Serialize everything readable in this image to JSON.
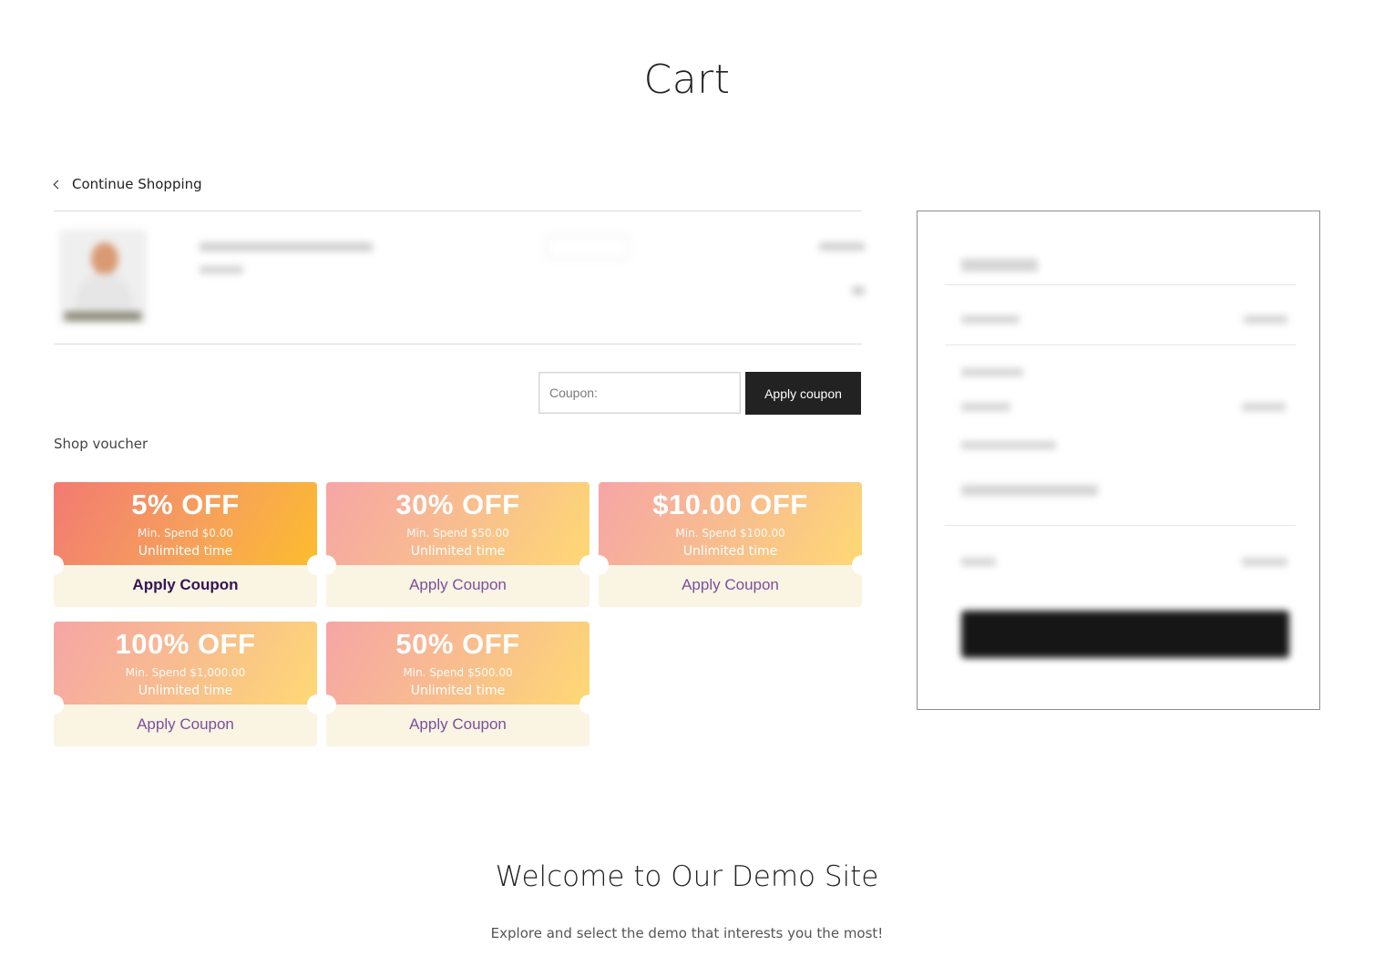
{
  "page": {
    "title": "Cart"
  },
  "nav": {
    "continue_label": "Continue Shopping"
  },
  "coupon": {
    "placeholder": "Coupon:",
    "apply_label": "Apply coupon"
  },
  "vouchers": {
    "label": "Shop voucher",
    "items": [
      {
        "amount": "5% OFF",
        "min_spend": "Min. Spend $0.00",
        "validity": "Unlimited time",
        "action": "Apply Coupon"
      },
      {
        "amount": "30% OFF",
        "min_spend": "Min. Spend $50.00",
        "validity": "Unlimited time",
        "action": "Apply Coupon"
      },
      {
        "amount": "$10.00 OFF",
        "min_spend": "Min. Spend $100.00",
        "validity": "Unlimited time",
        "action": "Apply Coupon"
      },
      {
        "amount": "100% OFF",
        "min_spend": "Min. Spend $1,000.00",
        "validity": "Unlimited time",
        "action": "Apply Coupon"
      },
      {
        "amount": "50% OFF",
        "min_spend": "Min. Spend $500.00",
        "validity": "Unlimited time",
        "action": "Apply Coupon"
      }
    ]
  },
  "footer": {
    "heading": "Welcome to Our Demo Site",
    "subheading": "Explore and select the demo that interests you the most!"
  },
  "colors": {
    "button_dark": "#222222",
    "voucher_action_text": "#7c4f9e",
    "voucher_action_text_highlight": "#341456",
    "voucher_bottom_bg": "#faf4e3"
  }
}
